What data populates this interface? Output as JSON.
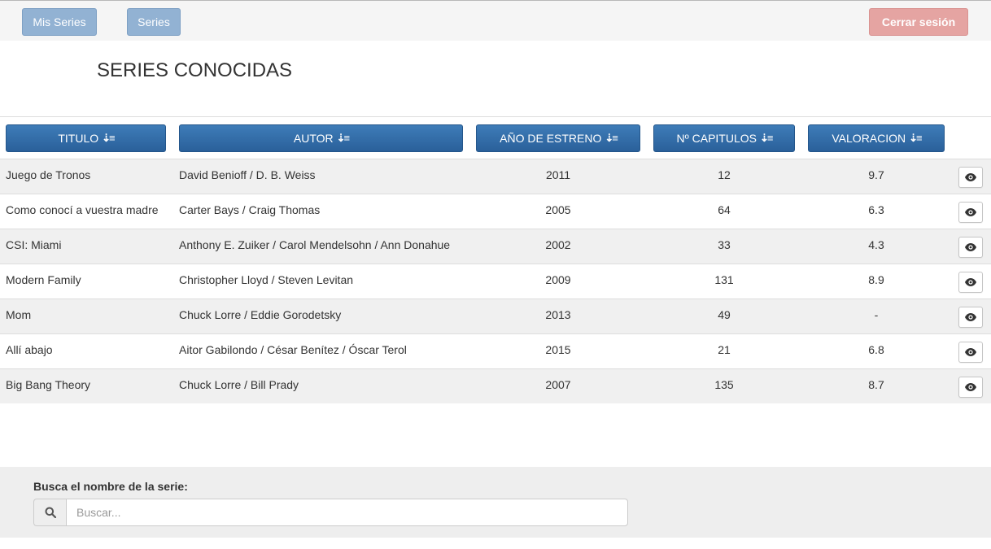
{
  "navbar": {
    "mis_series_label": "Mis Series",
    "series_label": "Series",
    "logout_label": "Cerrar sesión"
  },
  "page": {
    "title": "SERIES CONOCIDAS"
  },
  "table": {
    "headers": {
      "titulo": "TITULO",
      "autor": "AUTOR",
      "anio": "AÑO DE ESTRENO",
      "capitulos": "Nº CAPITULOS",
      "valoracion": "VALORACION"
    },
    "rows": [
      {
        "titulo": "Juego de Tronos",
        "autor": "David Benioff / D. B. Weiss",
        "anio": "2011",
        "capitulos": "12",
        "valoracion": "9.7"
      },
      {
        "titulo": "Como conocí a vuestra madre",
        "autor": "Carter Bays / Craig Thomas",
        "anio": "2005",
        "capitulos": "64",
        "valoracion": "6.3"
      },
      {
        "titulo": "CSI: Miami",
        "autor": "Anthony E. Zuiker / Carol Mendelsohn / Ann Donahue",
        "anio": "2002",
        "capitulos": "33",
        "valoracion": "4.3"
      },
      {
        "titulo": "Modern Family",
        "autor": "Christopher Lloyd / Steven Levitan",
        "anio": "2009",
        "capitulos": "131",
        "valoracion": "8.9"
      },
      {
        "titulo": "Mom",
        "autor": "Chuck Lorre / Eddie Gorodetsky",
        "anio": "2013",
        "capitulos": "49",
        "valoracion": "-"
      },
      {
        "titulo": "Allí abajo",
        "autor": "Aitor Gabilondo / César Benítez / Óscar Terol",
        "anio": "2015",
        "capitulos": "21",
        "valoracion": "6.8"
      },
      {
        "titulo": "Big Bang Theory",
        "autor": "Chuck Lorre / Bill Prady",
        "anio": "2007",
        "capitulos": "135",
        "valoracion": "8.7"
      }
    ]
  },
  "search": {
    "label": "Busca el nombre de la serie:",
    "placeholder": "Buscar...",
    "value": ""
  },
  "icons": {
    "sort": "sort-amount-down-icon",
    "view": "eye-icon",
    "search": "search-icon"
  },
  "colors": {
    "primary": "#2f6ba6",
    "nav_blue": "#92b2d3",
    "danger_light": "#e5a4a2",
    "row_stripe": "#f0f0f0"
  }
}
